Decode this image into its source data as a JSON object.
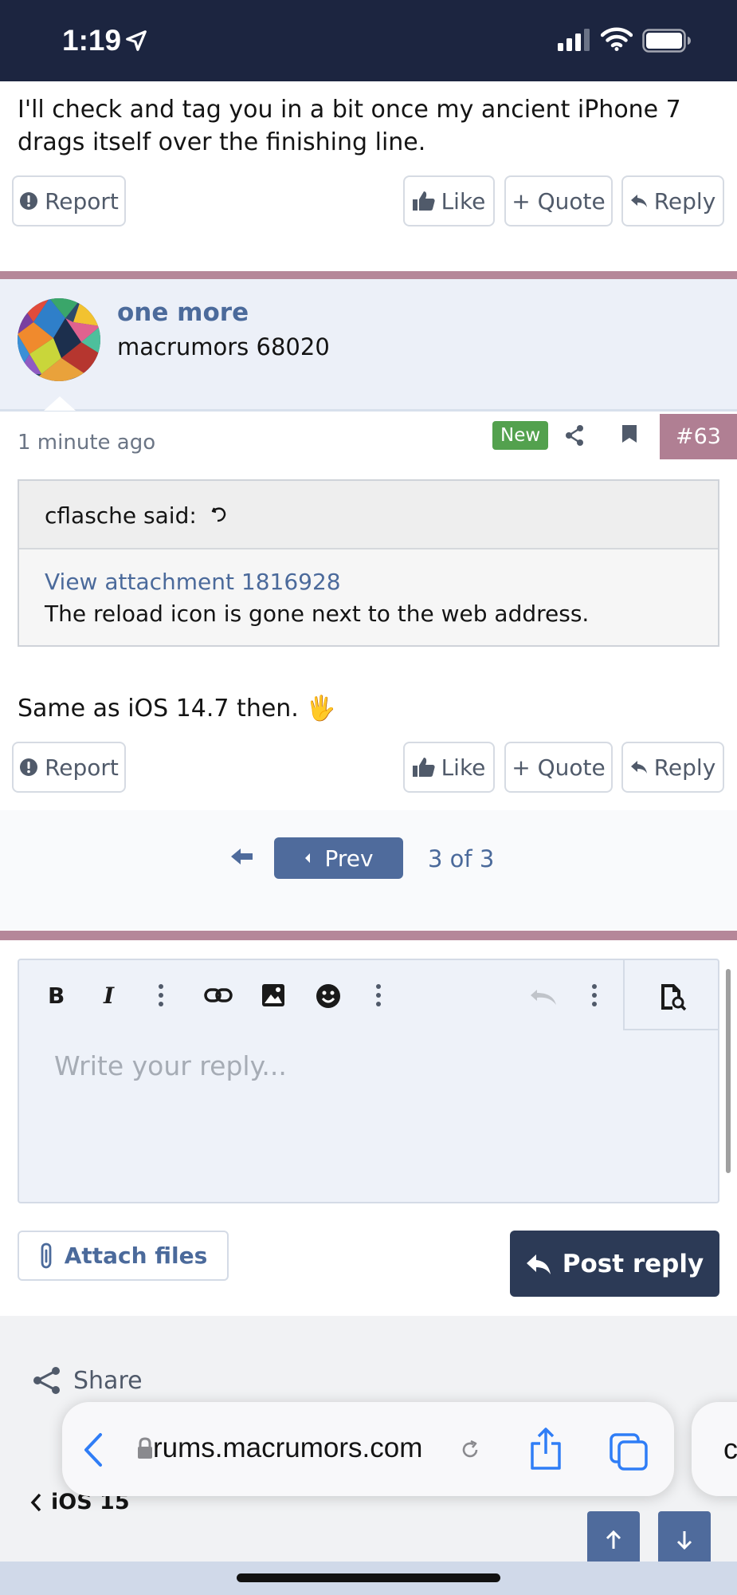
{
  "status_bar": {
    "time": "1:19"
  },
  "previous_post": {
    "text": "I'll check and tag you in a bit once my ancient iPhone 7 drags itself over the finishing line.",
    "actions": {
      "report": "Report",
      "like": "Like",
      "quote": "+ Quote",
      "reply": "Reply"
    }
  },
  "post": {
    "username": "one more",
    "user_title": "macrumors 68020",
    "time": "1 minute ago",
    "new_badge": "New",
    "number": "#63",
    "quote": {
      "author": "cflasche said:",
      "link": "View attachment 1816928",
      "text": "The reload icon is gone next to the web address."
    },
    "body": "Same as iOS 14.7 then. 🖐️",
    "actions": {
      "report": "Report",
      "like": "Like",
      "quote": "+ Quote",
      "reply": "Reply"
    }
  },
  "pagination": {
    "prev_label": "Prev",
    "page_info": "3 of 3"
  },
  "editor": {
    "placeholder": "Write your reply..."
  },
  "attach_label": "Attach files",
  "post_reply_label": "Post reply",
  "footer": {
    "share_label": "Share",
    "breadcrumb": "iOS 15"
  },
  "browser": {
    "url": "rums.macrumors.com",
    "next_tab_glyph": "c"
  },
  "colors": {
    "status_bar": "#1c2540",
    "accent": "#4b6a9b",
    "separator": "#b58799",
    "new_badge": "#53a14e",
    "post_reply_bg": "#2c3a56"
  }
}
